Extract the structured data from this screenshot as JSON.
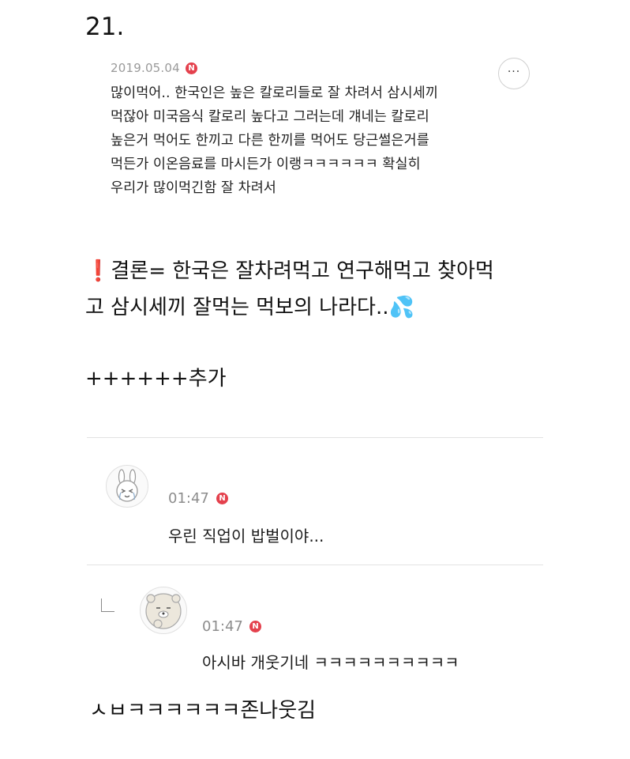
{
  "section": {
    "number": "21."
  },
  "comment": {
    "date": "2019.05.04",
    "badge": "N",
    "more_label": "···",
    "lines": [
      "많이먹어.. 한국인은 높은 칼로리들로 잘 차려서 삼시세끼",
      "먹잖아 미국음식 칼로리 높다고 그러는데 걔네는 칼로리",
      "높은거 먹어도 한끼고 다른 한끼를 먹어도 당근썰은거를",
      "먹든가 이온음료를 마시든가 이랭ㅋㅋㅋㅋㅋㅋ 확실히",
      "우리가 많이먹긴함 잘 차려서"
    ]
  },
  "conclusion": {
    "icon": "❗",
    "line1": "결론= 한국은 잘차려먹고 연구해먹고 찾아먹",
    "line2": "고 삼시세끼 잘먹는 먹보의 나라다..",
    "emoji": "💦"
  },
  "addition": {
    "text": "++++++추가"
  },
  "replies": [
    {
      "time": "01:47",
      "badge": "N",
      "text": "우린 직업이 밥벌이야..."
    },
    {
      "time": "01:47",
      "badge": "N",
      "text": "아시바 개웃기네 ㅋㅋㅋㅋㅋㅋㅋㅋㅋㅋ"
    }
  ],
  "footer": {
    "text": "ㅅㅂㅋㅋㅋㅋㅋㅋ존나웃김"
  },
  "colors": {
    "badge": "#e4414d",
    "divider": "#e2e2e2",
    "meta_text": "#9a9a9a"
  }
}
